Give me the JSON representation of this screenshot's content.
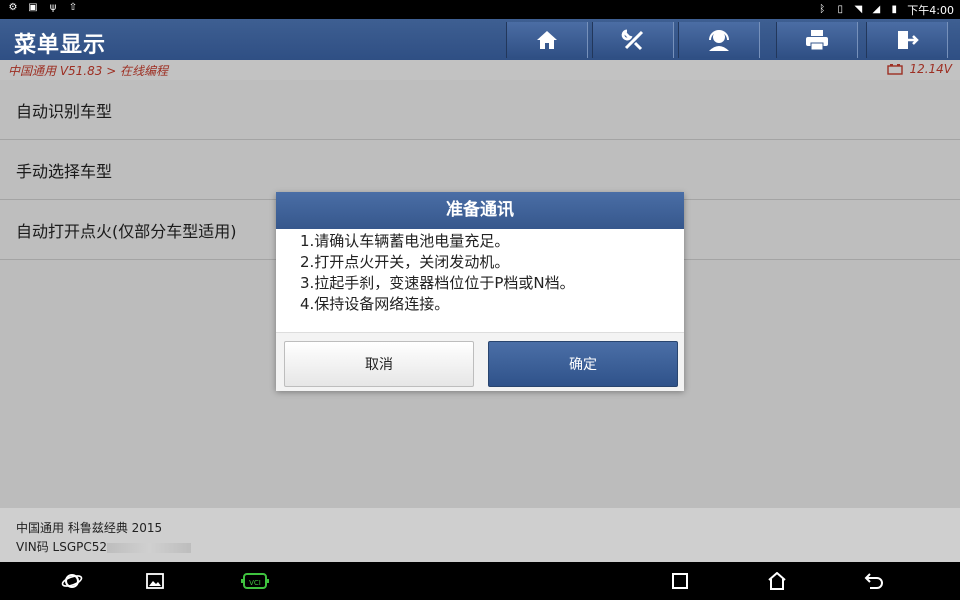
{
  "status_bar": {
    "time": "下午4:00",
    "left_icons": [
      "settings-icon",
      "image-icon",
      "usb-icon",
      "upload-icon"
    ],
    "right_icons": [
      "bluetooth-icon",
      "vibrate-icon",
      "wifi-icon",
      "signal-icon",
      "battery-icon"
    ]
  },
  "header": {
    "title": "菜单显示",
    "buttons": [
      "home-icon",
      "diagnostics-icon",
      "support-icon",
      "print-icon",
      "exit-icon"
    ]
  },
  "breadcrumb": {
    "path": "中国通用 V51.83 > 在线编程",
    "voltage": "12.14V"
  },
  "menu": {
    "items": [
      {
        "label": "自动识别车型"
      },
      {
        "label": "手动选择车型"
      },
      {
        "label": "自动打开点火(仅部分车型适用)"
      }
    ]
  },
  "dialog": {
    "title": "准备通讯",
    "lines": [
      "1.请确认车辆蓄电池电量充足。",
      "2.打开点火开关，关闭发动机。",
      "3.拉起手刹，变速器档位位于P档或N档。",
      "4.保持设备网络连接。"
    ],
    "cancel_label": "取消",
    "ok_label": "确定"
  },
  "footer": {
    "vehicle": "中国通用 科鲁兹经典 2015",
    "vin_label": "VIN码 LSGPC52"
  },
  "nav_bar": {
    "icons": [
      "browser-icon",
      "gallery-icon",
      "vci-icon",
      "recent-apps-icon",
      "home-nav-icon",
      "back-icon"
    ],
    "vci_label": "VCI"
  },
  "colors": {
    "header_blue": "#36578c",
    "breadcrumb_red": "#c03a2b",
    "vci_green": "#3fc33f"
  }
}
